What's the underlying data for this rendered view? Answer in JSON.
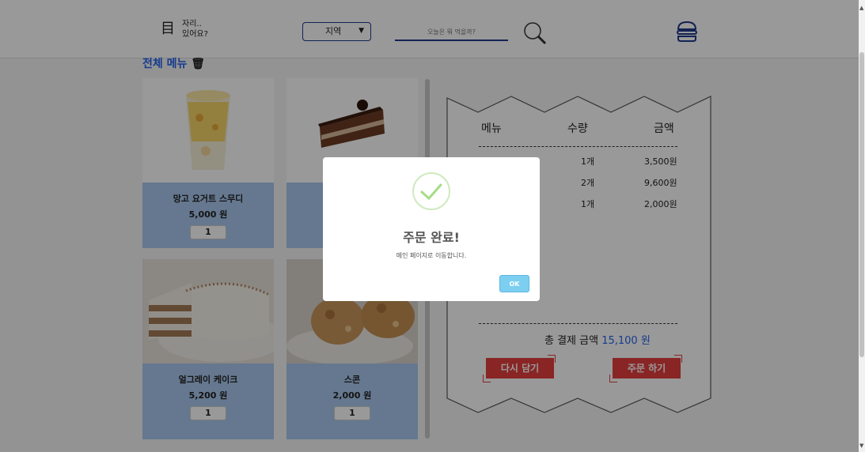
{
  "header": {
    "logo_icon": "目",
    "logo_line1": "자리..",
    "logo_line2": "있어요?",
    "region_select": "지역",
    "search_placeholder": "오늘은 뭐 먹을까?"
  },
  "section_title": "전체 메뉴",
  "menu_items": [
    {
      "name": "망고 요거트 스무디",
      "price": "5,000 원",
      "qty": "1"
    },
    {
      "name": "",
      "price": "",
      "qty": ""
    },
    {
      "name": "얼그레이 케이크",
      "price": "5,200 원",
      "qty": "1"
    },
    {
      "name": "스콘",
      "price": "2,000 원",
      "qty": "1"
    }
  ],
  "receipt": {
    "col_menu": "메뉴",
    "col_qty": "수량",
    "col_amount": "금액",
    "rows": [
      {
        "qty": "1개",
        "amount": "3,500원"
      },
      {
        "qty": "2개",
        "amount": "9,600원"
      },
      {
        "qty": "1개",
        "amount": "2,000원"
      }
    ],
    "total_label": "총 결제 금액",
    "total_value": "15,100 원",
    "reset_button": "다시 담기",
    "order_button": "주문 하기"
  },
  "modal": {
    "title": "주문 완료!",
    "message": "메인 페이지로 이동합니다.",
    "ok_label": "OK"
  },
  "colors": {
    "accent_blue": "#2563eb",
    "card_blue": "#a9c8ef",
    "button_red": "#e53e3e",
    "ok_blue": "#7ccff1",
    "check_green": "#a5dc86"
  }
}
